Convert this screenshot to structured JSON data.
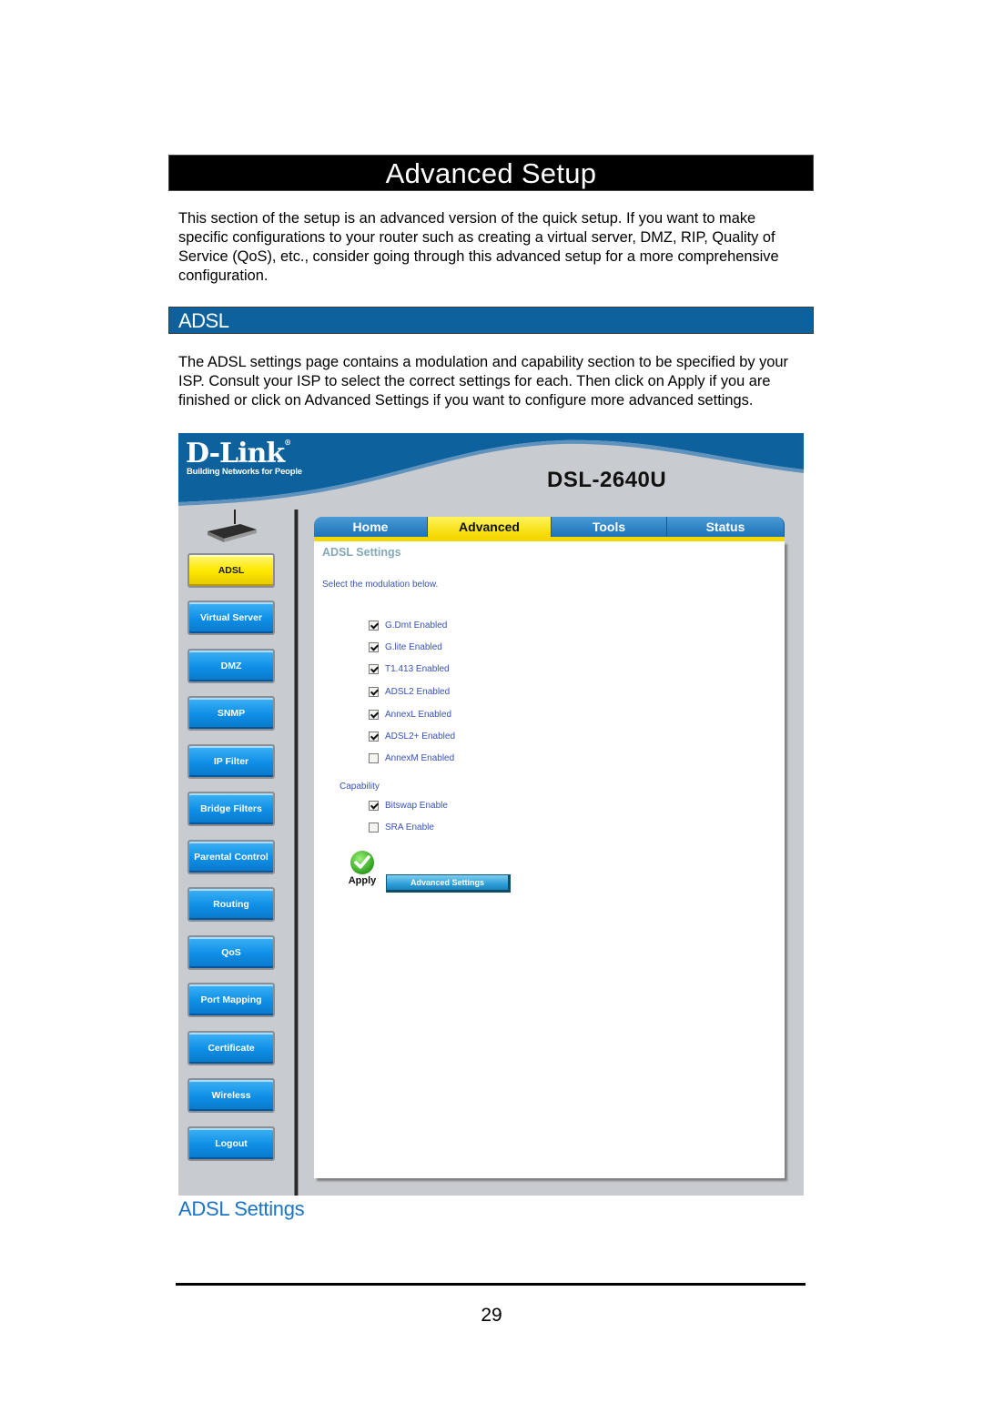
{
  "page": {
    "title": "Advanced Setup",
    "intro": "This section of the setup is an advanced version of the quick setup.  If you want to make specific configurations to your router such as creating a virtual server, DMZ, RIP, Quality of Service (QoS), etc., consider going through this advanced setup for a more comprehensive configuration.",
    "section_title": "ADSL",
    "section_text": "The ADSL settings page contains a modulation and capability section to be specified by your ISP.  Consult your ISP to select the correct settings for each.  Then click on Apply if you are finished or click on Advanced Settings if you want to configure more advanced settings.",
    "figure_caption": "ADSL Settings",
    "page_number": "29"
  },
  "router_ui": {
    "brand": "D-Link",
    "brand_reg": "®",
    "tagline": "Building Networks for People",
    "model": "DSL-2640U",
    "colors": {
      "header_blue": "#0d629d",
      "tab_active": "#f4d800",
      "button_blue": "#0d8ee6",
      "text_blue": "#3752b8"
    },
    "tabs": [
      {
        "label": "Home",
        "active": false
      },
      {
        "label": "Advanced",
        "active": true
      },
      {
        "label": "Tools",
        "active": false
      },
      {
        "label": "Status",
        "active": false
      }
    ],
    "sidebar": [
      {
        "label": "ADSL",
        "active": true
      },
      {
        "label": "Virtual Server",
        "active": false
      },
      {
        "label": "DMZ",
        "active": false
      },
      {
        "label": "SNMP",
        "active": false
      },
      {
        "label": "IP Filter",
        "active": false
      },
      {
        "label": "Bridge Filters",
        "active": false
      },
      {
        "label": "Parental Control",
        "active": false
      },
      {
        "label": "Routing",
        "active": false
      },
      {
        "label": "QoS",
        "active": false
      },
      {
        "label": "Port Mapping",
        "active": false
      },
      {
        "label": "Certificate",
        "active": false
      },
      {
        "label": "Wireless",
        "active": false
      },
      {
        "label": "Logout",
        "active": false
      }
    ],
    "panel": {
      "title": "ADSL Settings",
      "instruction": "Select the modulation below.",
      "modulation": [
        {
          "label": "G.Dmt Enabled",
          "checked": true
        },
        {
          "label": "G.lite Enabled",
          "checked": true
        },
        {
          "label": "T1.413 Enabled",
          "checked": true
        },
        {
          "label": "ADSL2 Enabled",
          "checked": true
        },
        {
          "label": "AnnexL Enabled",
          "checked": true
        },
        {
          "label": "ADSL2+ Enabled",
          "checked": true
        },
        {
          "label": "AnnexM Enabled",
          "checked": false
        }
      ],
      "capability_label": "Capability",
      "capability": [
        {
          "label": "Bitswap Enable",
          "checked": true
        },
        {
          "label": "SRA Enable",
          "checked": false
        }
      ],
      "apply_label": "Apply",
      "advanced_settings_label": "Advanced Settings"
    }
  }
}
